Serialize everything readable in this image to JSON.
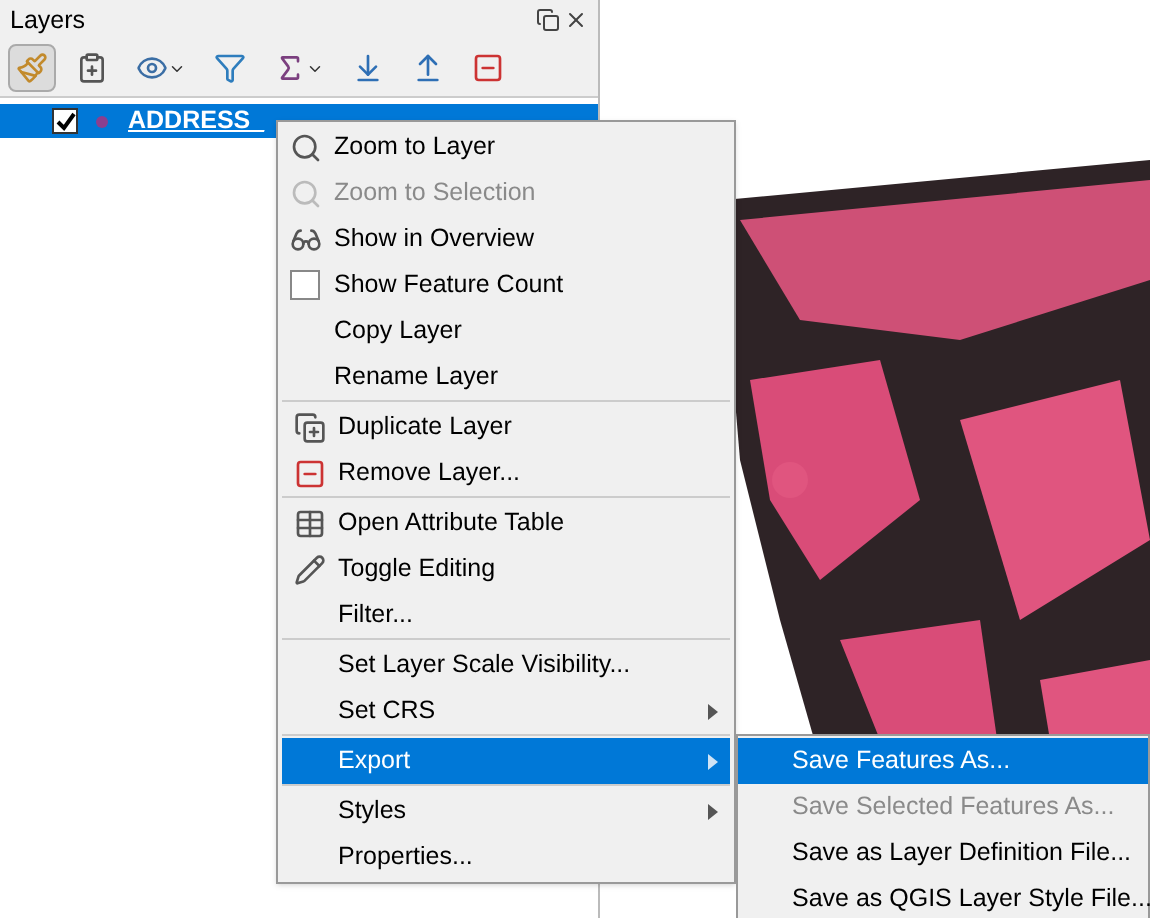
{
  "panel": {
    "title": "Layers"
  },
  "toolbar_buttons": [
    {
      "selected": true
    },
    {
      "selected": false
    },
    {
      "selected": false
    },
    {
      "selected": false
    },
    {
      "selected": false
    },
    {
      "selected": false
    },
    {
      "selected": false
    },
    {
      "selected": false
    }
  ],
  "layers": [
    {
      "name": "ADDRESS_",
      "checked": true,
      "selected": true
    }
  ],
  "context_menu": {
    "groups": [
      [
        {
          "kind": "action",
          "label": "Zoom to Layer",
          "disabled": false,
          "selected": false
        },
        {
          "kind": "action",
          "label": "Zoom to Selection",
          "disabled": true,
          "selected": false
        },
        {
          "kind": "action",
          "label": "Show in Overview",
          "disabled": false,
          "selected": false
        },
        {
          "kind": "checkbox",
          "label": "Show Feature Count",
          "checked": false,
          "disabled": false,
          "selected": false
        },
        {
          "kind": "action",
          "label": "Copy Layer",
          "disabled": false,
          "selected": false
        },
        {
          "kind": "action",
          "label": "Rename Layer",
          "disabled": false,
          "selected": false
        }
      ],
      [
        {
          "kind": "action",
          "label": "Duplicate Layer",
          "disabled": false,
          "selected": false
        },
        {
          "kind": "action",
          "label": "Remove Layer...",
          "disabled": false,
          "selected": false
        }
      ],
      [
        {
          "kind": "action",
          "label": "Open Attribute Table",
          "disabled": false,
          "selected": false
        },
        {
          "kind": "action",
          "label": "Toggle Editing",
          "disabled": false,
          "selected": false
        },
        {
          "kind": "action",
          "label": "Filter...",
          "disabled": false,
          "selected": false
        }
      ],
      [
        {
          "kind": "action",
          "label": "Set Layer Scale Visibility...",
          "disabled": false,
          "selected": false
        },
        {
          "kind": "submenu",
          "label": "Set CRS",
          "disabled": false,
          "selected": false
        }
      ],
      [
        {
          "kind": "submenu",
          "label": "Export",
          "disabled": false,
          "selected": true
        }
      ],
      [
        {
          "kind": "submenu",
          "label": "Styles",
          "disabled": false,
          "selected": false
        },
        {
          "kind": "action",
          "label": "Properties...",
          "disabled": false,
          "selected": false
        }
      ]
    ]
  },
  "submenu": [
    {
      "label": "Save Features As...",
      "disabled": false,
      "selected": true
    },
    {
      "label": "Save Selected Features As...",
      "disabled": true,
      "selected": false
    },
    {
      "label": "Save as Layer Definition File...",
      "disabled": false,
      "selected": false
    },
    {
      "label": "Save as QGIS Layer Style File...",
      "disabled": false,
      "selected": false
    }
  ]
}
